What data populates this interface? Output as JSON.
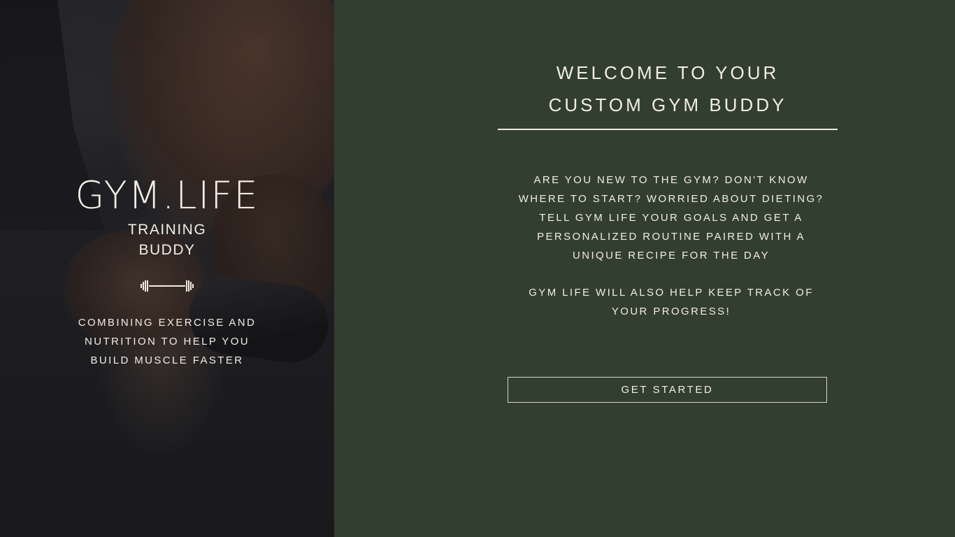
{
  "hero": {
    "brand_title": "GYM.LIFE",
    "brand_subtitle_line1": "TRAINING",
    "brand_subtitle_line2": "BUDDY",
    "icon": "dumbbell-icon",
    "tagline_line1": "COMBINING EXERCISE AND",
    "tagline_line2": "NUTRITION TO HELP YOU",
    "tagline_line3": "BUILD MUSCLE FASTER"
  },
  "welcome": {
    "heading_line1": "WELCOME TO YOUR",
    "heading_line2": "CUSTOM GYM BUDDY",
    "intro_line1": "ARE YOU NEW TO THE GYM? DON'T KNOW",
    "intro_line2": "WHERE TO START? WORRIED ABOUT DIETING?",
    "intro_line3": "TELL GYM LIFE YOUR GOALS AND GET A",
    "intro_line4": "PERSONALIZED ROUTINE PAIRED WITH A",
    "intro_line5": "UNIQUE RECIPE FOR THE DAY",
    "progress_line1": "GYM LIFE WILL ALSO HELP KEEP TRACK OF",
    "progress_line2": "YOUR PROGRESS!",
    "cta_label": "GET STARTED"
  },
  "colors": {
    "panel_background": "#323e2f",
    "text": "#f1ede6",
    "hero_overlay": "#232327"
  }
}
